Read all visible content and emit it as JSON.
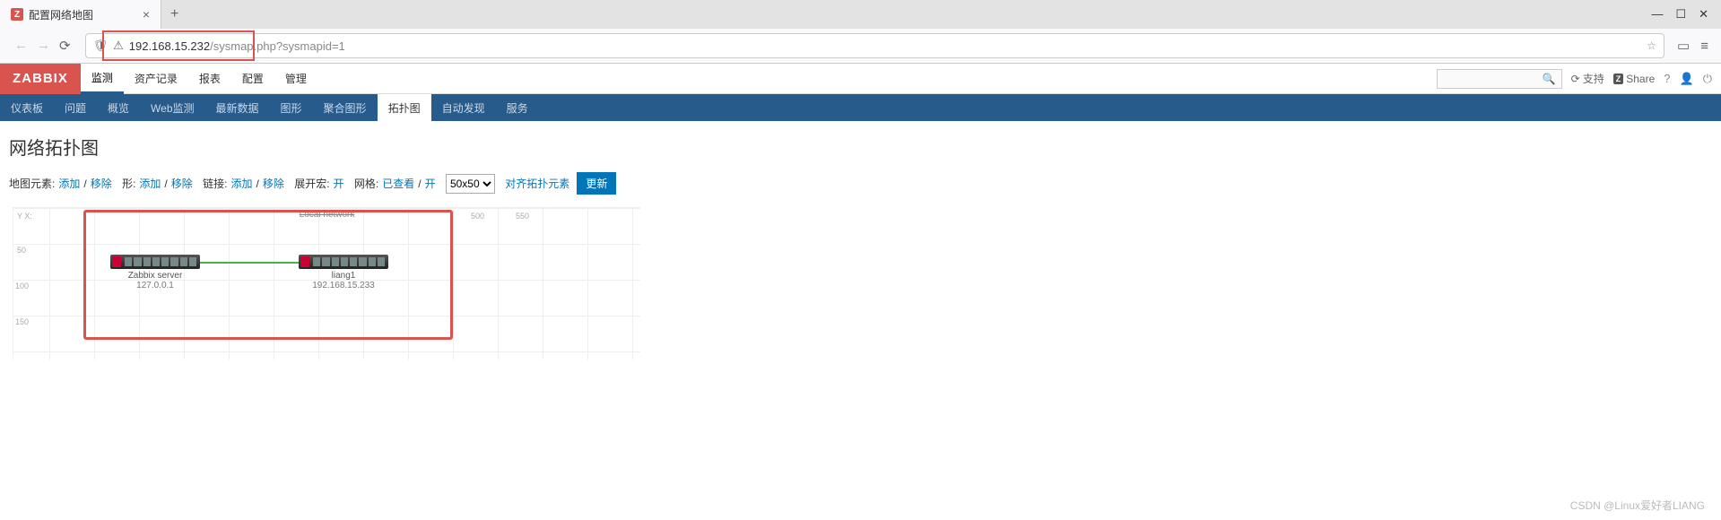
{
  "browser": {
    "tab_title": "配置网络地图",
    "tab_favicon_letter": "Z",
    "url_host": "192.168.15.232",
    "url_path": "/sysmap.php",
    "url_query": "?sysmapid=1"
  },
  "zabbix": {
    "logo": "ZABBIX",
    "main_nav": [
      "监测",
      "资产记录",
      "报表",
      "配置",
      "管理"
    ],
    "main_nav_active": 0,
    "header_support": "支持",
    "header_share": "Share",
    "sub_nav": [
      "仪表板",
      "问题",
      "概览",
      "Web监测",
      "最新数据",
      "图形",
      "聚合图形",
      "拓扑图",
      "自动发现",
      "服务"
    ],
    "sub_nav_active": 7
  },
  "page": {
    "title": "网络拓扑图",
    "toolbar": {
      "element_label": "地图元素:",
      "add": "添加",
      "remove": "移除",
      "shape_label": "形:",
      "link_label": "链接:",
      "expand_label": "展开宏:",
      "on": "开",
      "grid_label": "网格:",
      "shown": "已查看",
      "grid_select": "50x50",
      "align": "对齐拓扑元素",
      "update": "更新"
    },
    "map": {
      "title": "Local network",
      "y_label": "Y X:",
      "y_ticks": [
        "50",
        "100",
        "150"
      ],
      "x_ticks": [
        "500",
        "550"
      ],
      "nodes": [
        {
          "name": "Zabbix server",
          "addr": "127.0.0.1"
        },
        {
          "name": "liang1",
          "addr": "192.168.15.233"
        }
      ]
    }
  },
  "watermark": "CSDN @Linux爱好者LIANG"
}
